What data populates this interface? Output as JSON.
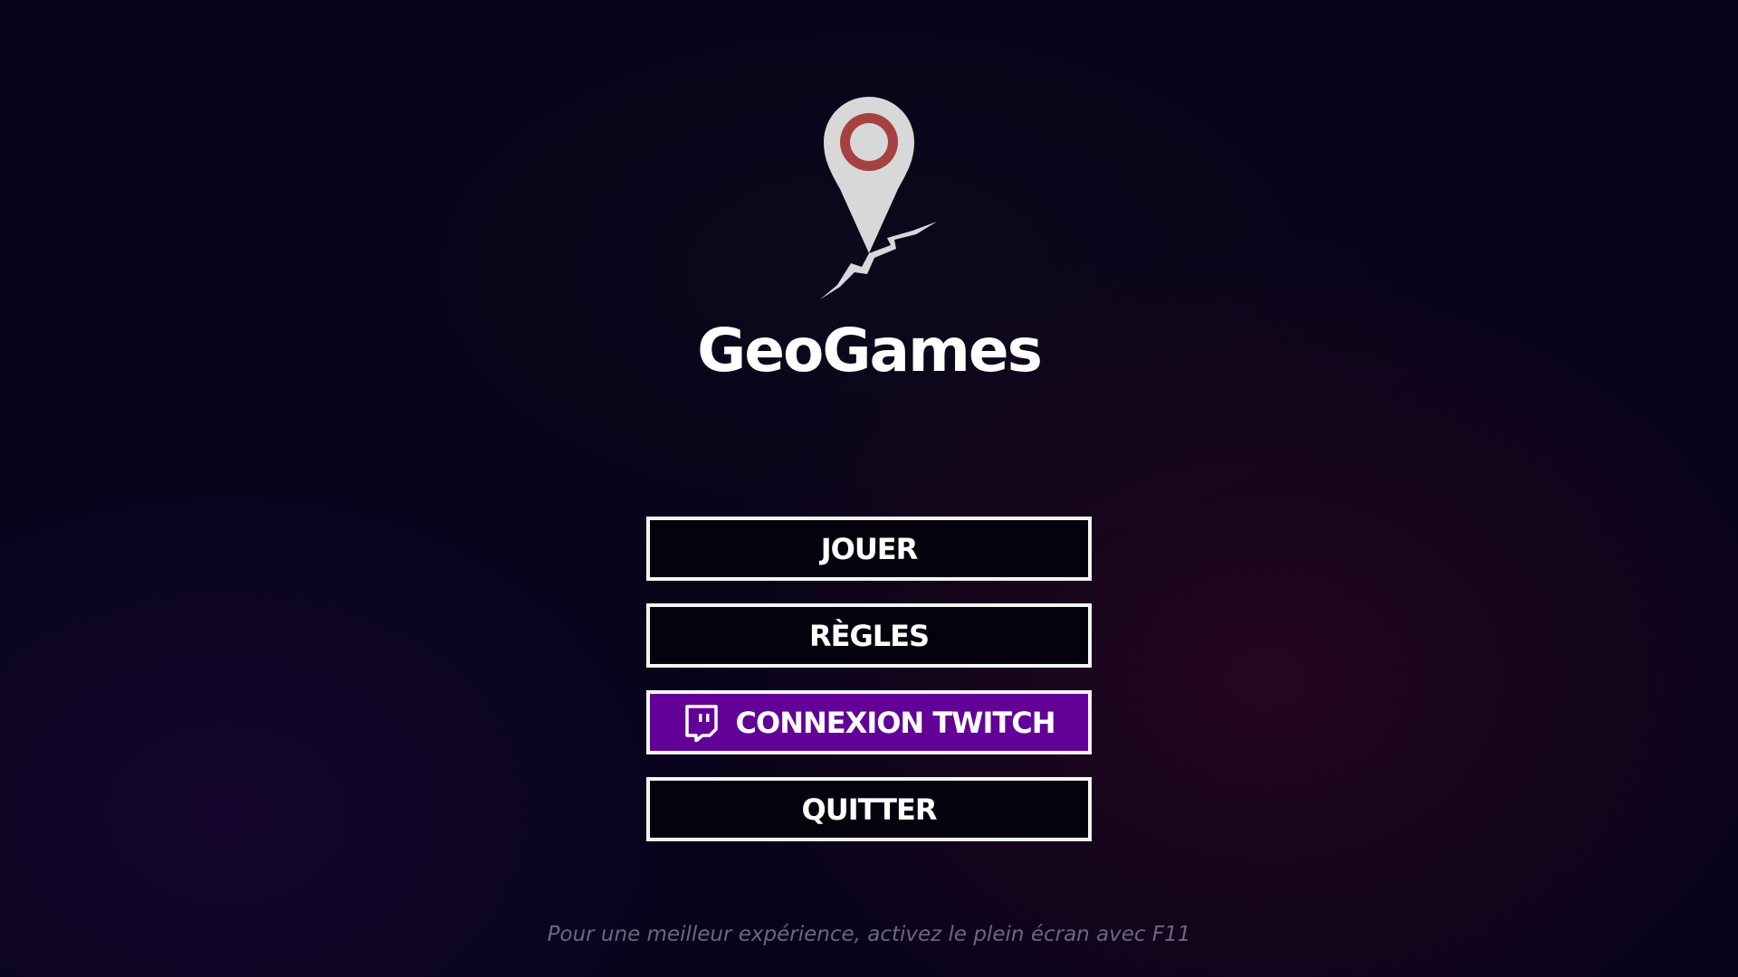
{
  "app": {
    "title": "GeoGames",
    "logo_icon": "map-pin-icon"
  },
  "menu": {
    "items": [
      {
        "label": "JOUER",
        "icon": null
      },
      {
        "label": "RÈGLES",
        "icon": null
      },
      {
        "label": "CONNEXION TWITCH",
        "icon": "twitch-icon"
      },
      {
        "label": "QUITTER",
        "icon": null
      }
    ]
  },
  "footer": {
    "hint": "Pour une meilleur expérience, activez le plein écran avec F11"
  },
  "colors": {
    "background": "#07041a",
    "button_background": "#05020d",
    "button_border": "#f4f4f4",
    "twitch_purple": "#630097",
    "pin_ring": "#a64142",
    "pin_body": "#d8d8d8",
    "hint_text": "#6d6680"
  }
}
